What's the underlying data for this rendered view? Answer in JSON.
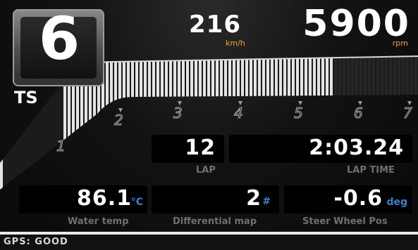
{
  "gear": {
    "value": "6",
    "mode": "TS"
  },
  "speed": {
    "value": "216",
    "unit": "km/h"
  },
  "rpm": {
    "value": "5900",
    "unit": "rpm",
    "scale_labels": [
      "1",
      "2",
      "3",
      "4",
      "5",
      "6",
      "7"
    ],
    "fill_fraction": 0.79
  },
  "lap": {
    "value": "12",
    "label": "LAP"
  },
  "lap_time": {
    "value": "2:03.24",
    "label": "LAP TIME"
  },
  "water_temp": {
    "value": "86.1",
    "unit": "°C",
    "label": "Water temp"
  },
  "differential_map": {
    "value": "2",
    "unit": "#",
    "label": "Differential map"
  },
  "steer_wheel_pos": {
    "value": "-0.6",
    "unit": "deg",
    "label": "Steer Wheel Pos"
  },
  "status": {
    "gps": "GPS: GOOD"
  },
  "colors": {
    "accent_orange": "#f2a52a",
    "unit_blue": "#3f7fd0"
  }
}
